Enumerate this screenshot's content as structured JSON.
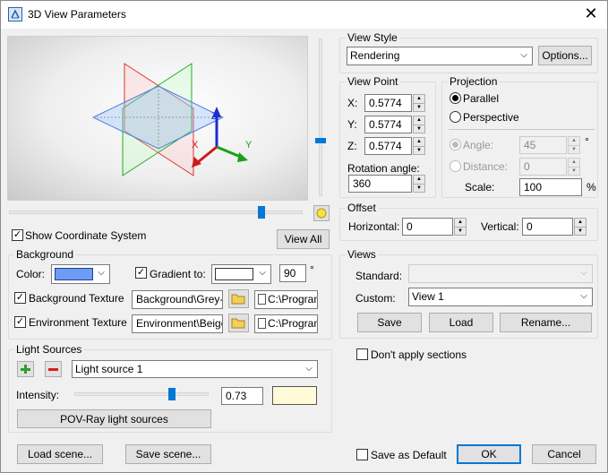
{
  "window": {
    "title": "3D View Parameters"
  },
  "view_style": {
    "label": "View Style",
    "value": "Rendering",
    "options_btn": "Options..."
  },
  "view_point": {
    "label": "View Point",
    "x_label": "X:",
    "y_label": "Y:",
    "z_label": "Z:",
    "x": "0.5774",
    "y": "0.5774",
    "z": "0.5774",
    "rotation_label": "Rotation angle:",
    "rotation": "360"
  },
  "projection": {
    "label": "Projection",
    "parallel": "Parallel",
    "perspective": "Perspective",
    "angle_label": "Angle:",
    "angle": "45",
    "degree": "°",
    "distance_label": "Distance:",
    "distance": "0",
    "scale_label": "Scale:",
    "scale": "100",
    "percent": "%"
  },
  "offset": {
    "label": "Offset",
    "horizontal_label": "Horizontal:",
    "horizontal": "0",
    "vertical_label": "Vertical:",
    "vertical": "0"
  },
  "views": {
    "label": "Views",
    "standard_label": "Standard:",
    "standard": "",
    "custom_label": "Custom:",
    "custom": "View 1",
    "save": "Save",
    "load": "Load",
    "rename": "Rename..."
  },
  "dont_apply_sections": "Don't apply sections",
  "show_coordinate_system": "Show Coordinate System",
  "view_all": "View All",
  "background": {
    "label": "Background",
    "color_label": "Color:",
    "color": "#6f9cf2",
    "gradient_label": "Gradient to:",
    "gradient_color": "#ffffff",
    "gradient_angle": "90",
    "degree": "°",
    "bg_texture_label": "Background Texture",
    "bg_texture": "Background\\Grey-bl",
    "bg_path": "C:\\Progran",
    "env_texture_label": "Environment Texture",
    "env_texture": "Environment\\Beige_",
    "env_path": "C:\\Progran"
  },
  "light_sources": {
    "label": "Light Sources",
    "selected": "Light source 1",
    "intensity_label": "Intensity:",
    "intensity": "0.73",
    "intensity_level": 0.73,
    "pov_ray_button": "POV-Ray light sources"
  },
  "footer": {
    "load_scene": "Load scene...",
    "save_scene": "Save scene...",
    "save_default": "Save as Default",
    "ok": "OK",
    "cancel": "Cancel"
  }
}
